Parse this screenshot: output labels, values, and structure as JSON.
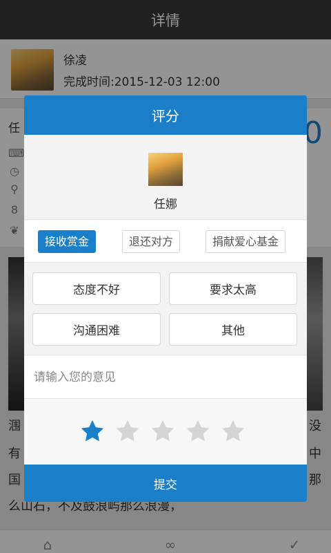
{
  "header": {
    "title": "详情"
  },
  "user": {
    "name": "徐凌",
    "completion_time": "完成时间:2015-12-03 12:00"
  },
  "task": {
    "title_fragment": "任",
    "number_fragment": "0"
  },
  "background_text": {
    "line1_left": "涠",
    "line1_right": "没",
    "line2_left": "有",
    "line2_right": "中",
    "line3_left": "国",
    "line3_right": "那",
    "line4": "么山石，不及鼓浪屿那么浪漫，"
  },
  "dialog": {
    "title": "评分",
    "rated_user": {
      "name": "任娜"
    },
    "reward_options": [
      {
        "label": "接收赏金",
        "selected": true
      },
      {
        "label": "退还对方",
        "selected": false
      },
      {
        "label": "捐献爱心基金",
        "selected": false
      }
    ],
    "reasons": [
      "态度不好",
      "要求太高",
      "沟通困难",
      "其他"
    ],
    "opinion_placeholder": "请输入您的意见",
    "rating": {
      "value": 1,
      "max": 5
    },
    "submit_label": "提交"
  },
  "colors": {
    "accent": "#1a7ec8",
    "topbar": "#3a3a3a",
    "star_inactive": "#d4d4d4"
  },
  "icons": [
    "keyboard-icon",
    "clock-icon",
    "location-icon",
    "people-icon",
    "leaf-icon",
    "gift-icon",
    "chain-icon",
    "check-circle-icon"
  ]
}
